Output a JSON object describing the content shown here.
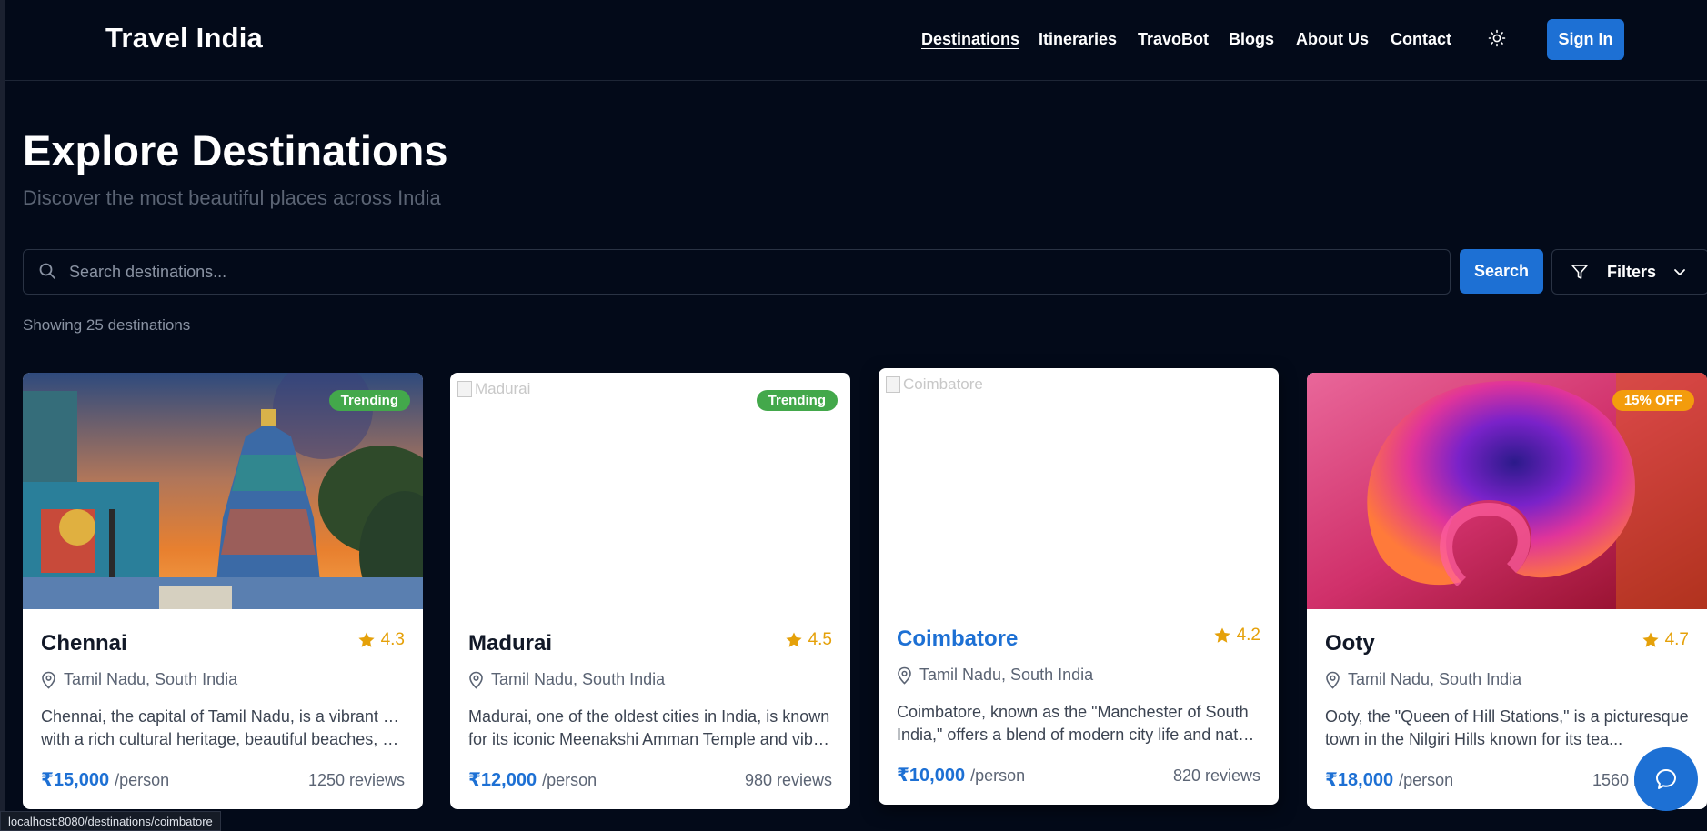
{
  "header": {
    "brand": "Travel India",
    "nav": [
      "Destinations",
      "Itineraries",
      "TravoBot",
      "Blogs",
      "About Us",
      "Contact"
    ],
    "active_nav": "Destinations",
    "theme_toggle_icon": "sun-icon",
    "sign_in": "Sign In"
  },
  "hero": {
    "title": "Explore Destinations",
    "subtitle": "Discover the most beautiful places across India"
  },
  "search": {
    "placeholder": "Search destinations...",
    "button": "Search",
    "filters": "Filters"
  },
  "results": {
    "count_text": "Showing 25 destinations"
  },
  "cards": [
    {
      "name": "Chennai",
      "image": "photo",
      "badge": "Trending",
      "rating": "4.3",
      "location": "Tamil Nadu, South India",
      "desc_line1": "Chennai, the capital of Tamil Nadu, is a vibrant city",
      "desc_line2": "with a rich cultural heritage, beautiful beaches, an...",
      "price": "₹15,000",
      "per": "/person",
      "reviews": "1250 reviews"
    },
    {
      "name": "Madurai",
      "image": "broken",
      "image_alt": "Madurai",
      "badge": "Trending",
      "rating": "4.5",
      "location": "Tamil Nadu, South India",
      "desc_line1": "Madurai, one of the oldest cities in India, is known",
      "desc_line2": "for its iconic Meenakshi Amman Temple and vibra...",
      "price": "₹12,000",
      "per": "/person",
      "reviews": "980 reviews"
    },
    {
      "name": "Coimbatore",
      "image": "broken",
      "image_alt": "Coimbatore",
      "rating": "4.2",
      "location": "Tamil Nadu, South India",
      "desc_line1": "Coimbatore, known as the \"Manchester of South",
      "desc_line2": "India,\" offers a blend of modern city life and natur...",
      "price": "₹10,000",
      "per": "/person",
      "reviews": "820 reviews"
    },
    {
      "name": "Ooty",
      "image": "abstract",
      "badge": "15% OFF",
      "rating": "4.7",
      "location": "Tamil Nadu, South India",
      "desc_line1": "Ooty, the \"Queen of Hill Stations,\" is a picturesque",
      "desc_line2": "town in the Nilgiri Hills known for its tea...",
      "price": "₹18,000",
      "per": "/person",
      "reviews": "1560 reviews"
    }
  ],
  "chat_icon": "chat-bubble-icon",
  "status_url": "localhost:8080/destinations/coimbatore",
  "colors": {
    "background": "#030a19",
    "accent": "#1d70d4",
    "trending": "#43a84b",
    "discount": "#f39c0d",
    "star": "#e5a10a"
  }
}
